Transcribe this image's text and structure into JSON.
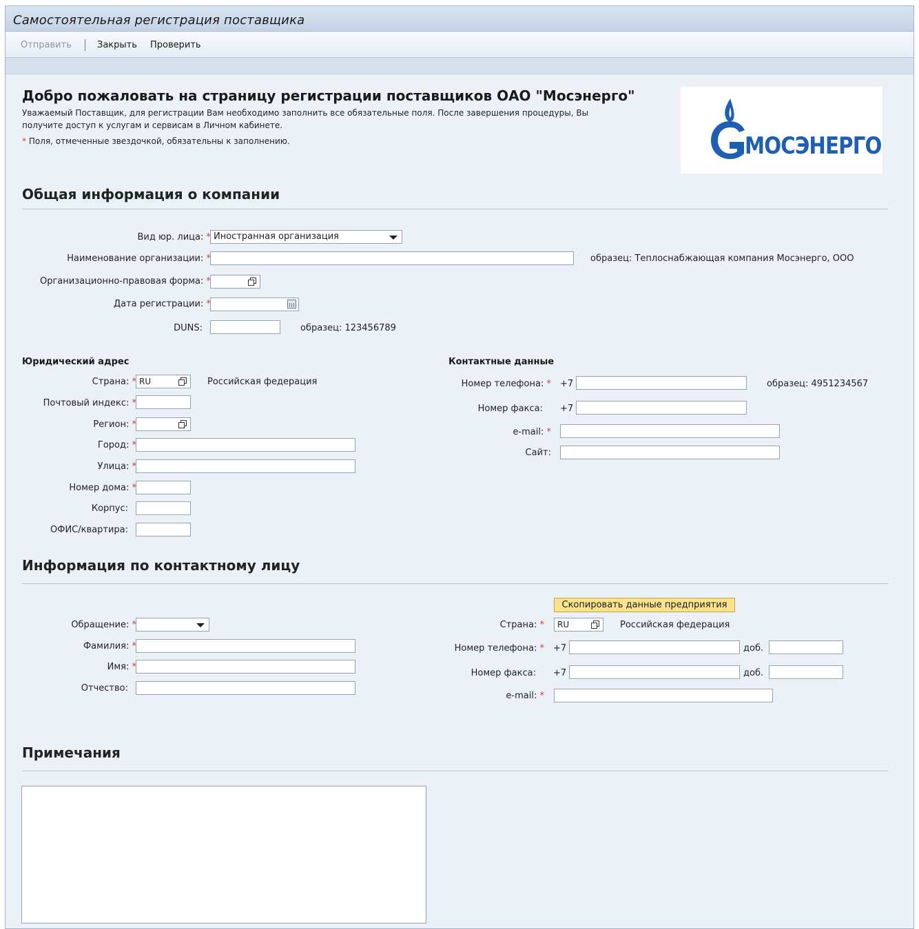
{
  "window": {
    "title": "Самостоятельная регистрация поставщика"
  },
  "toolbar": {
    "send": "Отправить",
    "close": "Закрыть",
    "check": "Проверить"
  },
  "header": {
    "title": "Добро пожаловать на страницу регистрации поставщиков ОАО \"Мосэнерго\"",
    "desc_line1": "Уважаемый Поставщик, для регистрации Вам необходимо заполнить все обязательные поля. После завершения процедуры, Вы",
    "desc_line2": "получите доступ к услугам и сервисам в Личном кабинете.",
    "required_note": "Поля, отмеченные звездочкой, обязательны к заполнению.",
    "logo_text": "МОСЭНЕРГО"
  },
  "company": {
    "section_title": "Общая информация о компании",
    "legal_type_label": "Вид юр. лица:",
    "legal_type_value": "Иностранная организация",
    "org_name_label": "Наименование организации:",
    "org_name_hint": "образец: Теплоснабжающая компания Мосэнерго, ООО",
    "legal_form_label": "Организационно-правовая форма:",
    "reg_date_label": "Дата регистрации:",
    "duns_label": "DUNS:",
    "duns_hint": "образец: 123456789"
  },
  "address": {
    "section_title": "Юридический адрес",
    "country_label": "Страна:",
    "country_code": "RU",
    "country_name": "Российская федерация",
    "zip_label": "Почтовый индекс:",
    "region_label": "Регион:",
    "city_label": "Город:",
    "street_label": "Улица:",
    "house_label": "Номер дома:",
    "building_label": "Корпус:",
    "office_label": "ОФИС/квартира:"
  },
  "contacts": {
    "section_title": "Контактные данные",
    "phone_label": "Номер телефона:",
    "phone_prefix": "+7",
    "phone_hint": "образец: 4951234567",
    "fax_label": "Номер факса:",
    "fax_prefix": "+7",
    "email_label": "e-mail:",
    "site_label": "Сайт:"
  },
  "person": {
    "section_title": "Информация по контактному лицу",
    "copy_button": "Скопировать данные предприятия",
    "salutation_label": "Обращение:",
    "lastname_label": "Фамилия:",
    "firstname_label": "Имя:",
    "middlename_label": "Отчество:",
    "country_label": "Страна:",
    "country_code": "RU",
    "country_name": "Российская федерация",
    "phone_label": "Номер телефона:",
    "phone_prefix": "+7",
    "ext_label": "доб.",
    "fax_label": "Номер факса:",
    "fax_prefix": "+7",
    "fax_ext_label": "доб.",
    "email_label": "e-mail:"
  },
  "notes": {
    "section_title": "Примечания"
  },
  "colors": {
    "required": "#d43a3a",
    "copy_button_bg": "#fbe28c",
    "logo_blue": "#1f5fb3"
  }
}
